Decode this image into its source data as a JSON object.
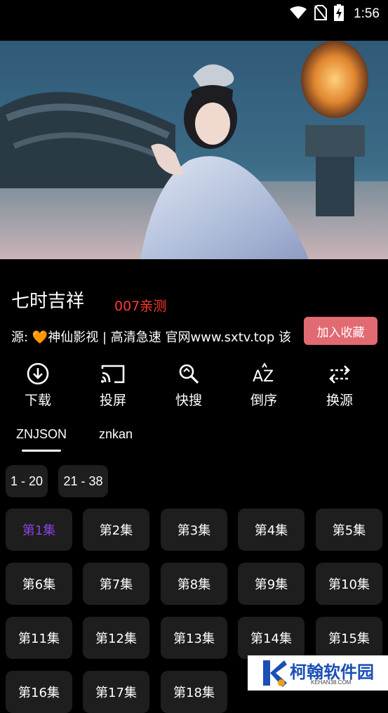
{
  "status_bar": {
    "time": "1:56",
    "icons": [
      "wifi-icon",
      "no-sim-icon",
      "battery-charging-icon"
    ]
  },
  "video": {
    "description_icon": "video-player"
  },
  "detail": {
    "title": "七时吉祥",
    "tag": "007亲测",
    "source_prefix": "源: ",
    "source_heart": "🧡",
    "source_text": "神仙影视 | 高清急速 官网www.sxtv.top",
    "source_overflow": "该",
    "favorite_label": "加入收藏"
  },
  "actions": [
    {
      "label": "下载",
      "icon": "download-icon"
    },
    {
      "label": "投屏",
      "icon": "cast-icon"
    },
    {
      "label": "快搜",
      "icon": "quick-search-icon"
    },
    {
      "label": "倒序",
      "icon": "sort-reverse-icon"
    },
    {
      "label": "换源",
      "icon": "switch-source-icon"
    }
  ],
  "tabs": [
    {
      "label": "ZNJSON",
      "active": true
    },
    {
      "label": "znkan",
      "active": false
    }
  ],
  "ranges": [
    "1 - 20",
    "21 - 38"
  ],
  "episodes": [
    "第1集",
    "第2集",
    "第3集",
    "第4集",
    "第5集",
    "第6集",
    "第7集",
    "第8集",
    "第9集",
    "第10集",
    "第11集",
    "第12集",
    "第13集",
    "第14集",
    "第15集",
    "第16集",
    "第17集",
    "第18集"
  ],
  "active_episode": "第1集",
  "colors": {
    "accent_purple": "#8a43e0",
    "tag_red": "#ff3b30",
    "favorite_pink": "#e26a73",
    "tile_bg": "#1e1e1e"
  },
  "watermark": {
    "title": "柯翰软件园",
    "sub": "KEHAN38.COM"
  }
}
